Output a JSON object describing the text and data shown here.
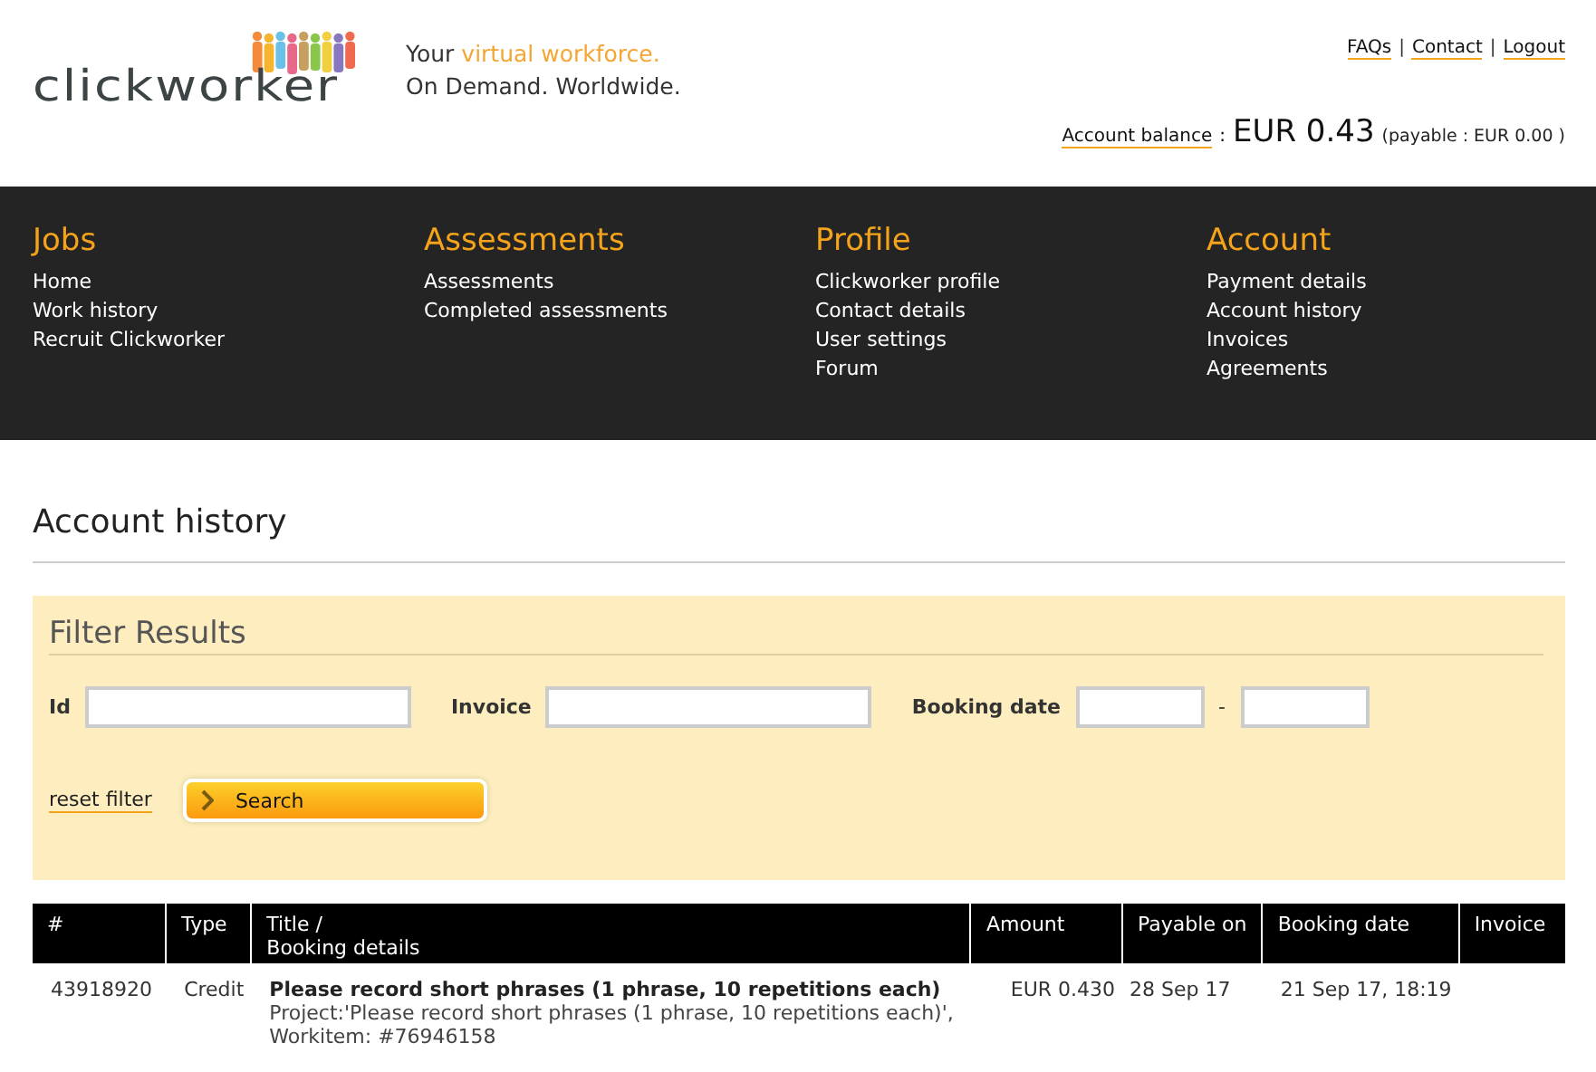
{
  "logo": {
    "text": "clickworker"
  },
  "tagline": {
    "line_1_start": "Your ",
    "line_1_highlight": "virtual workforce.",
    "line_2": "On Demand. Worldwide."
  },
  "top_links": [
    "FAQs",
    "Contact",
    "Logout"
  ],
  "top_links_separator": "|",
  "balance": {
    "label": "Account balance",
    "separator": ":",
    "amount": "EUR 0.43",
    "payable": "(payable : EUR 0.00 )"
  },
  "nav": [
    {
      "heading": "Jobs",
      "links": [
        "Home",
        "Work history",
        "Recruit Clickworker"
      ]
    },
    {
      "heading": "Assessments",
      "links": [
        "Assessments",
        "Completed assessments"
      ]
    },
    {
      "heading": "Profile",
      "links": [
        "Clickworker profile",
        "Contact details",
        "User settings",
        "Forum"
      ]
    },
    {
      "heading": "Account",
      "links": [
        "Payment details",
        "Account history",
        "Invoices",
        "Agreements"
      ]
    }
  ],
  "page_title": "Account history",
  "filter": {
    "title": "Filter Results",
    "fields": [
      {
        "label": "Id",
        "kind": "single"
      },
      {
        "label": "Invoice",
        "kind": "single"
      },
      {
        "label": "Booking date",
        "kind": "range",
        "separator": "-"
      }
    ],
    "reset_link": "reset filter",
    "search_button": "Search"
  },
  "table": {
    "columns": [
      "#",
      "Type",
      "Title /\nBooking details",
      "Amount",
      "Payable on",
      "Booking date",
      "Invoice"
    ],
    "rows": [
      {
        "id": "43918920",
        "type": "Credit",
        "title": "Please record short phrases (1 phrase, 10 repetitions each)",
        "details": [
          "Project:'Please record short phrases (1 phrase, 10 repetitions each)',",
          "Workitem: #76946158"
        ],
        "amount": "EUR 0.430",
        "payable_on": "28 Sep 17",
        "booking_date": "21 Sep 17, 18:19"
      }
    ]
  }
}
